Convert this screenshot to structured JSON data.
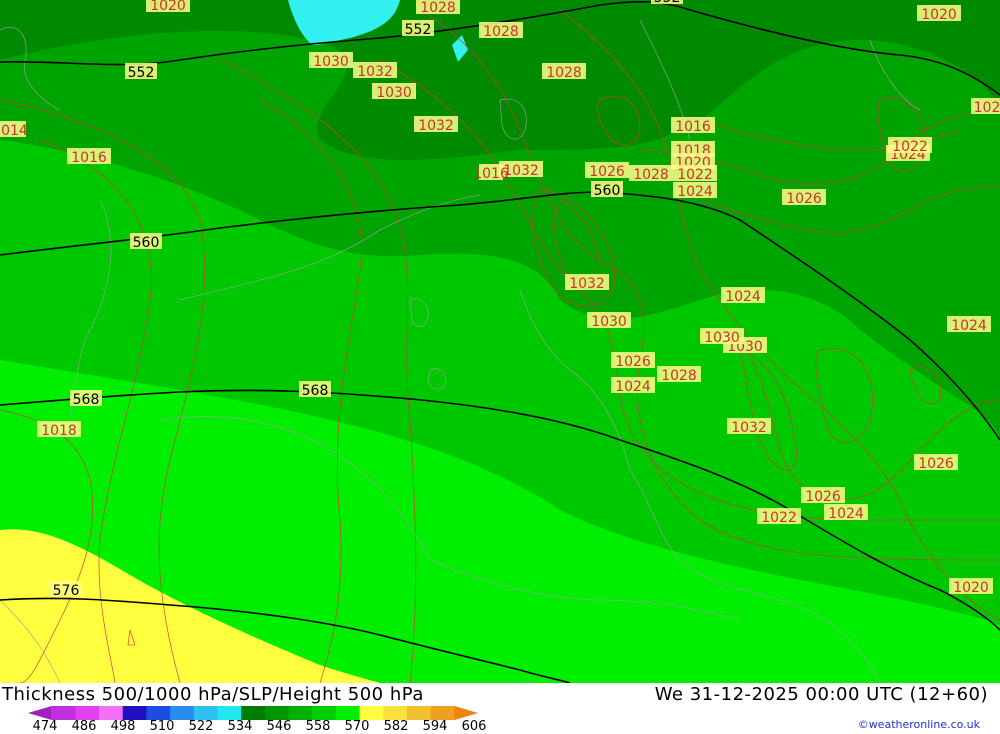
{
  "title": "Thickness 500/1000 hPa/SLP/Height 500 hPa",
  "valid_time": "We 31-12-2025 00:00 UTC (12+60)",
  "credit": "©weatheronline.co.uk",
  "scale": {
    "ticks": [
      "474",
      "486",
      "498",
      "510",
      "522",
      "534",
      "546",
      "558",
      "570",
      "582",
      "594",
      "606"
    ],
    "colors": [
      "#a020c0",
      "#c030e0",
      "#e040f0",
      "#f070f8",
      "#2010c0",
      "#1a4ee0",
      "#2a8cf0",
      "#30c0f0",
      "#20e8f0",
      "#007c00",
      "#009600",
      "#00b000",
      "#00ce00",
      "#00ee00",
      "#ffff40",
      "#f8e040",
      "#f0c030",
      "#f0a020",
      "#f08010"
    ]
  },
  "colors": {
    "band_534": "#008a00",
    "band_546": "#00a400",
    "band_558": "#00c800",
    "band_570": "#00ee00",
    "band_582": "#ffff40",
    "cold_526": "#30f0f0",
    "isobar": "#d23c3c",
    "height_contour": "#000000",
    "border": "#9aa0a0"
  },
  "height_labels": [
    {
      "text": "552"
    },
    {
      "text": "552"
    },
    {
      "text": "552"
    },
    {
      "text": "560"
    },
    {
      "text": "560"
    },
    {
      "text": "568"
    },
    {
      "text": "568"
    },
    {
      "text": "576"
    }
  ],
  "slp_labels": [
    {
      "text": "1020"
    },
    {
      "text": "1028"
    },
    {
      "text": "1028"
    },
    {
      "text": "1028"
    },
    {
      "text": "1030"
    },
    {
      "text": "1032"
    },
    {
      "text": "1030"
    },
    {
      "text": "1032"
    },
    {
      "text": "1016"
    },
    {
      "text": "1016"
    },
    {
      "text": "1018"
    },
    {
      "text": "1020"
    },
    {
      "text": "1022"
    },
    {
      "text": "1024"
    },
    {
      "text": "1026"
    },
    {
      "text": "1028"
    },
    {
      "text": "1032"
    },
    {
      "text": "1032"
    },
    {
      "text": "1030"
    },
    {
      "text": "1026"
    },
    {
      "text": "1024"
    },
    {
      "text": "1028"
    },
    {
      "text": "1030"
    },
    {
      "text": "1032"
    },
    {
      "text": "1026"
    },
    {
      "text": "1022"
    },
    {
      "text": "1024"
    },
    {
      "text": "1024"
    },
    {
      "text": "1024"
    },
    {
      "text": "1026"
    },
    {
      "text": "1024"
    },
    {
      "text": "1022"
    },
    {
      "text": "1020"
    },
    {
      "text": "1020"
    },
    {
      "text": "1018"
    },
    {
      "text": "1016"
    },
    {
      "text": "1014"
    },
    {
      "text": "102"
    },
    {
      "text": "1026"
    },
    {
      "text": "1030"
    }
  ]
}
